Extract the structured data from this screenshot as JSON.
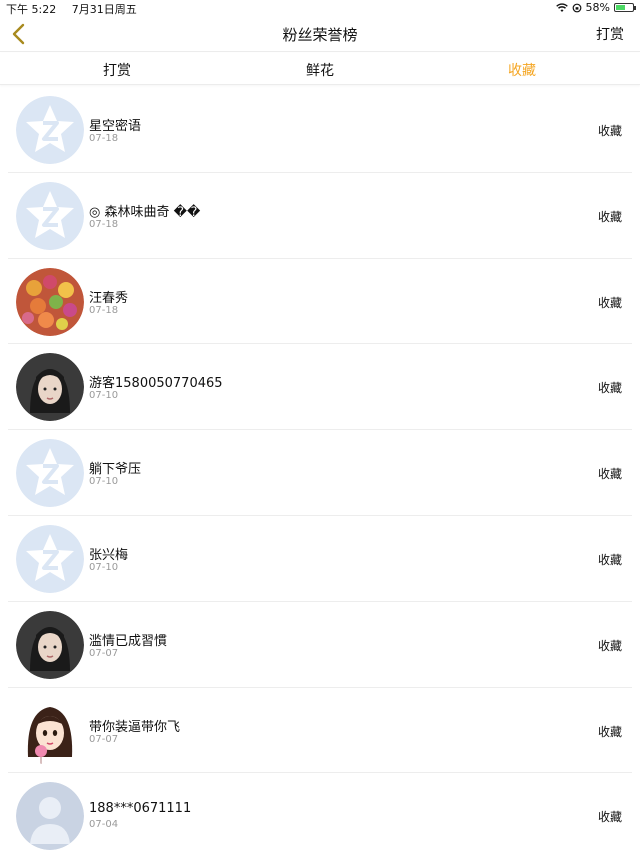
{
  "status_bar": {
    "time": "下午 5:22",
    "date": "7月31日周五",
    "battery": "58%",
    "battery_level": 0.58,
    "battery_color": "#4cd964"
  },
  "nav": {
    "back_icon": "chevron-left-icon",
    "title": "粉丝荣誉榜",
    "right_label": "打赏"
  },
  "tabs": [
    {
      "label": "打赏",
      "active": false
    },
    {
      "label": "鲜花",
      "active": false
    },
    {
      "label": "收藏",
      "active": true
    }
  ],
  "colors": {
    "accent": "#f5a623",
    "default_avatar_bg": "#dbe6f4"
  },
  "list": [
    {
      "name": "星空密语",
      "date": "07-18",
      "action": "收藏",
      "avatar": "default-qq-avatar"
    },
    {
      "name": "◎ 森林味曲奇 ��",
      "date": "07-18",
      "action": "收藏",
      "avatar": "default-qq-avatar"
    },
    {
      "name": "汪春秀",
      "date": "07-18",
      "action": "收藏",
      "avatar": "candy-photo-avatar"
    },
    {
      "name": "游客1580050770465",
      "date": "07-10",
      "action": "收藏",
      "avatar": "girl-photo-avatar"
    },
    {
      "name": "躺下爷压",
      "date": "07-10",
      "action": "收藏",
      "avatar": "default-qq-avatar"
    },
    {
      "name": "张兴梅",
      "date": "07-10",
      "action": "收藏",
      "avatar": "default-qq-avatar"
    },
    {
      "name": "滥情已成習慣",
      "date": "07-07",
      "action": "收藏",
      "avatar": "girl-photo-avatar"
    },
    {
      "name": "带你装逼带你飞",
      "date": "07-07",
      "action": "收藏",
      "avatar": "cartoon-girl-avatar"
    },
    {
      "name": "188***0671111",
      "date": "07-04",
      "action": "收藏",
      "avatar": "default-person-avatar"
    }
  ]
}
